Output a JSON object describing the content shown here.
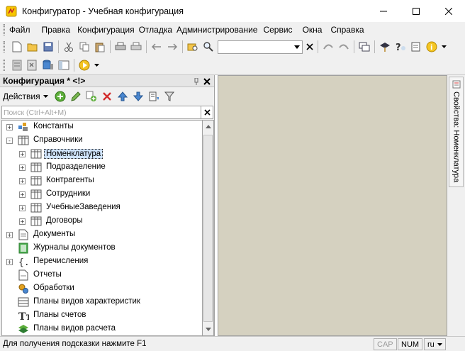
{
  "window": {
    "title": "Конфигуратор - Учебная конфигурация"
  },
  "menu": [
    {
      "label": "Файл"
    },
    {
      "label": "Правка"
    },
    {
      "label": "Конфигурация"
    },
    {
      "label": "Отладка"
    },
    {
      "label": "Администрирование"
    },
    {
      "label": "Сервис"
    },
    {
      "label": "Окна"
    },
    {
      "label": "Справка"
    }
  ],
  "toolbar": {
    "search_value": ""
  },
  "panel": {
    "title": "Конфигурация * <!>",
    "actions_label": "Действия",
    "search_placeholder": "Поиск (Ctrl+Alt+M)"
  },
  "tree": [
    {
      "label": "Константы",
      "icon": "constants-icon",
      "level": 0,
      "expander": "+"
    },
    {
      "label": "Справочники",
      "icon": "catalog-icon",
      "level": 0,
      "expander": "-"
    },
    {
      "label": "Номенклатура",
      "icon": "catalog-icon",
      "level": 1,
      "expander": "+",
      "selected": true
    },
    {
      "label": "Подразделение",
      "icon": "catalog-icon",
      "level": 1,
      "expander": "+"
    },
    {
      "label": "Контрагенты",
      "icon": "catalog-icon",
      "level": 1,
      "expander": "+"
    },
    {
      "label": "Сотрудники",
      "icon": "catalog-icon",
      "level": 1,
      "expander": "+"
    },
    {
      "label": "УчебныеЗаведения",
      "icon": "catalog-icon",
      "level": 1,
      "expander": "+"
    },
    {
      "label": "Договоры",
      "icon": "catalog-icon",
      "level": 1,
      "expander": "+"
    },
    {
      "label": "Документы",
      "icon": "document-icon",
      "level": 0,
      "expander": "+"
    },
    {
      "label": "Журналы документов",
      "icon": "journal-icon",
      "level": 0,
      "expander": ""
    },
    {
      "label": "Перечисления",
      "icon": "enum-icon",
      "level": 0,
      "expander": "+"
    },
    {
      "label": "Отчеты",
      "icon": "report-icon",
      "level": 0,
      "expander": ""
    },
    {
      "label": "Обработки",
      "icon": "processing-icon",
      "level": 0,
      "expander": ""
    },
    {
      "label": "Планы видов характеристик",
      "icon": "chart-of-characteristics-icon",
      "level": 0,
      "expander": ""
    },
    {
      "label": "Планы счетов",
      "icon": "chart-of-accounts-icon",
      "level": 0,
      "expander": ""
    },
    {
      "label": "Планы видов расчета",
      "icon": "chart-of-calculation-icon",
      "level": 0,
      "expander": ""
    }
  ],
  "side_tab": {
    "label": "Свойства: Номенклатура"
  },
  "status": {
    "hint": "Для получения подсказки нажмите F1",
    "cap": "CAP",
    "num": "NUM",
    "lang": "ru"
  },
  "colors": {
    "workspace": "#d5d1c0",
    "selection": "#cfe3fb",
    "chrome": "#f0f0f0"
  }
}
